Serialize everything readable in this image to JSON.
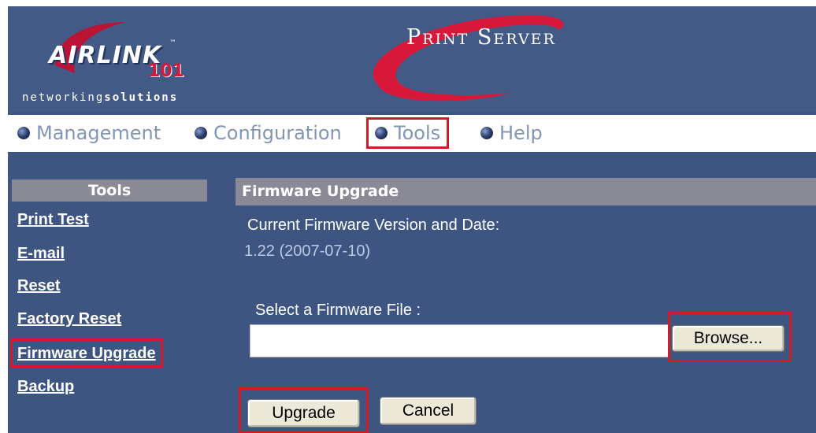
{
  "header": {
    "logo": {
      "word": "AIRLINK",
      "tm": "™",
      "number": "101",
      "tagline_part1": "networking",
      "tagline_part2": "solutions"
    },
    "product_title": "Print Server"
  },
  "nav": {
    "items": [
      {
        "label": "Management",
        "active": false
      },
      {
        "label": "Configuration",
        "active": false
      },
      {
        "label": "Tools",
        "active": true
      },
      {
        "label": "Help",
        "active": false
      }
    ]
  },
  "sidebar": {
    "title": "Tools",
    "items": [
      {
        "label": "Print Test",
        "active": false
      },
      {
        "label": "E-mail",
        "active": false
      },
      {
        "label": "Reset",
        "active": false
      },
      {
        "label": "Factory Reset",
        "active": false
      },
      {
        "label": "Firmware Upgrade",
        "active": true
      },
      {
        "label": "Backup",
        "active": false
      }
    ]
  },
  "main": {
    "title": "Firmware Upgrade",
    "version_label": "Current Firmware Version and Date:",
    "version_value": "1.22 (2007-07-10)",
    "file_label": "Select a Firmware File :",
    "file_value": "",
    "browse_label": "Browse...",
    "upgrade_label": "Upgrade",
    "cancel_label": "Cancel"
  },
  "colors": {
    "background": "#3d5580",
    "highlight": "#d11a2a",
    "section_bar": "#8a8a96",
    "swoosh": "#d8183a"
  }
}
